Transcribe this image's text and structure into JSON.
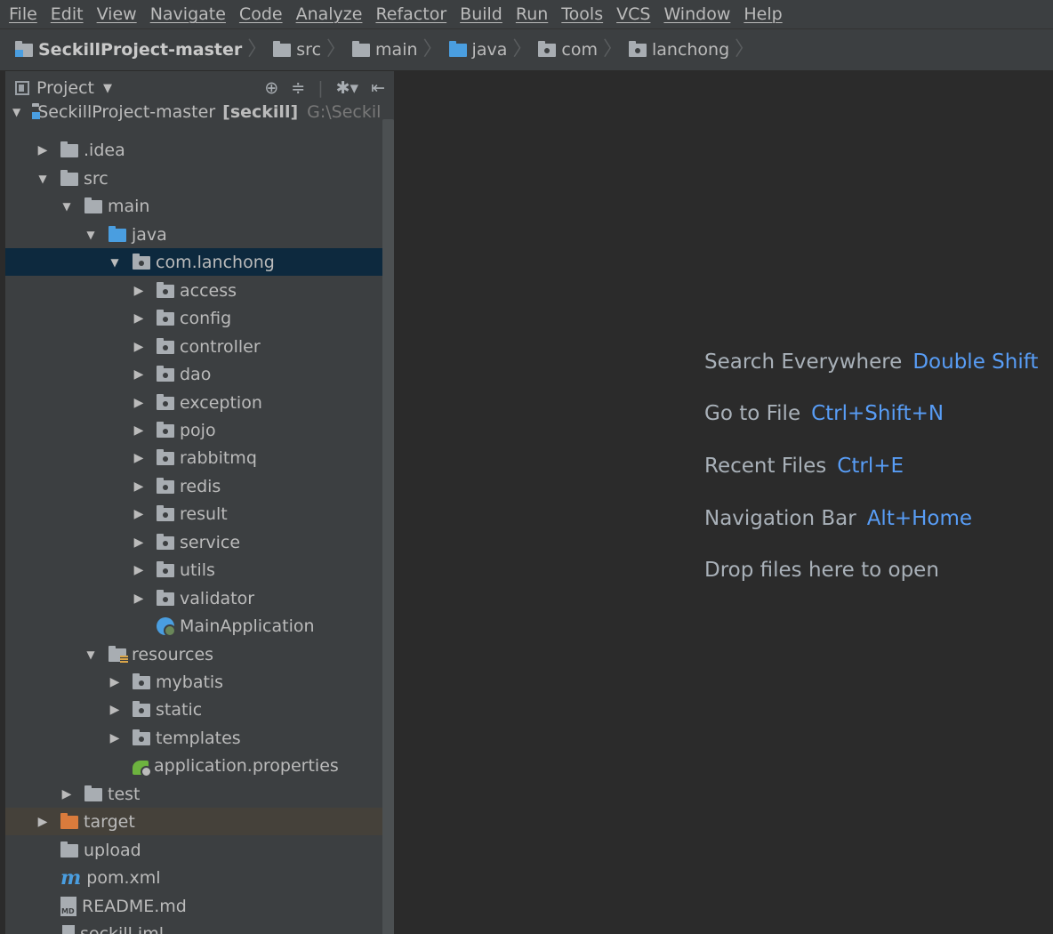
{
  "menu": [
    "File",
    "Edit",
    "View",
    "Navigate",
    "Code",
    "Analyze",
    "Refactor",
    "Build",
    "Run",
    "Tools",
    "VCS",
    "Window",
    "Help"
  ],
  "breadcrumb": [
    {
      "label": "SeckillProject-master",
      "icon": "module-folder-icon"
    },
    {
      "label": "src",
      "icon": "folder-icon"
    },
    {
      "label": "main",
      "icon": "folder-icon"
    },
    {
      "label": "java",
      "icon": "source-folder-icon"
    },
    {
      "label": "com",
      "icon": "package-icon"
    },
    {
      "label": "lanchong",
      "icon": "package-icon"
    }
  ],
  "panel": {
    "title": "Project",
    "tree": [
      {
        "label": "SeckillProject-master",
        "extra": "[seckill]",
        "path": "G:\\SeckillProj",
        "depth": 0,
        "arrow": "open",
        "icon": "module",
        "bold_extra": true
      },
      {
        "label": ".idea",
        "depth": 1,
        "arrow": "closed",
        "icon": "folder"
      },
      {
        "label": "src",
        "depth": 1,
        "arrow": "open",
        "icon": "folder"
      },
      {
        "label": "main",
        "depth": 2,
        "arrow": "open",
        "icon": "folder"
      },
      {
        "label": "java",
        "depth": 3,
        "arrow": "open",
        "icon": "blue"
      },
      {
        "label": "com.lanchong",
        "depth": 4,
        "arrow": "open",
        "icon": "pkg",
        "selected": true
      },
      {
        "label": "access",
        "depth": 5,
        "arrow": "closed",
        "icon": "pkg"
      },
      {
        "label": "config",
        "depth": 5,
        "arrow": "closed",
        "icon": "pkg"
      },
      {
        "label": "controller",
        "depth": 5,
        "arrow": "closed",
        "icon": "pkg"
      },
      {
        "label": "dao",
        "depth": 5,
        "arrow": "closed",
        "icon": "pkg"
      },
      {
        "label": "exception",
        "depth": 5,
        "arrow": "closed",
        "icon": "pkg"
      },
      {
        "label": "pojo",
        "depth": 5,
        "arrow": "closed",
        "icon": "pkg"
      },
      {
        "label": "rabbitmq",
        "depth": 5,
        "arrow": "closed",
        "icon": "pkg"
      },
      {
        "label": "redis",
        "depth": 5,
        "arrow": "closed",
        "icon": "pkg"
      },
      {
        "label": "result",
        "depth": 5,
        "arrow": "closed",
        "icon": "pkg"
      },
      {
        "label": "service",
        "depth": 5,
        "arrow": "closed",
        "icon": "pkg"
      },
      {
        "label": "utils",
        "depth": 5,
        "arrow": "closed",
        "icon": "pkg"
      },
      {
        "label": "validator",
        "depth": 5,
        "arrow": "closed",
        "icon": "pkg"
      },
      {
        "label": "MainApplication",
        "depth": 5,
        "arrow": "none",
        "icon": "main-app"
      },
      {
        "label": "resources",
        "depth": 3,
        "arrow": "open",
        "icon": "res"
      },
      {
        "label": "mybatis",
        "depth": 4,
        "arrow": "closed",
        "icon": "pkg"
      },
      {
        "label": "static",
        "depth": 4,
        "arrow": "closed",
        "icon": "pkg"
      },
      {
        "label": "templates",
        "depth": 4,
        "arrow": "closed",
        "icon": "pkg"
      },
      {
        "label": "application.properties",
        "depth": 4,
        "arrow": "none",
        "icon": "spring"
      },
      {
        "label": "test",
        "depth": 2,
        "arrow": "closed",
        "icon": "folder"
      },
      {
        "label": "target",
        "depth": 1,
        "arrow": "closed",
        "icon": "orange",
        "excluded": true
      },
      {
        "label": "upload",
        "depth": 1,
        "arrow": "none",
        "icon": "folder"
      },
      {
        "label": "pom.xml",
        "depth": 1,
        "arrow": "none",
        "icon": "maven"
      },
      {
        "label": "README.md",
        "depth": 1,
        "arrow": "none",
        "icon": "md"
      },
      {
        "label": "seckill.iml",
        "depth": 1,
        "arrow": "none",
        "icon": "iml"
      }
    ]
  },
  "editor": {
    "hints": [
      {
        "label": "Search Everywhere",
        "key": "Double Shift"
      },
      {
        "label": "Go to File",
        "key": "Ctrl+Shift+N"
      },
      {
        "label": "Recent Files",
        "key": "Ctrl+E"
      },
      {
        "label": "Navigation Bar",
        "key": "Alt+Home"
      },
      {
        "label": "Drop files here to open",
        "key": ""
      }
    ]
  },
  "colors": {
    "accent": "#589df6",
    "selection": "#0d293e",
    "panel": "#3c3f41",
    "editor": "#2b2b2b"
  }
}
